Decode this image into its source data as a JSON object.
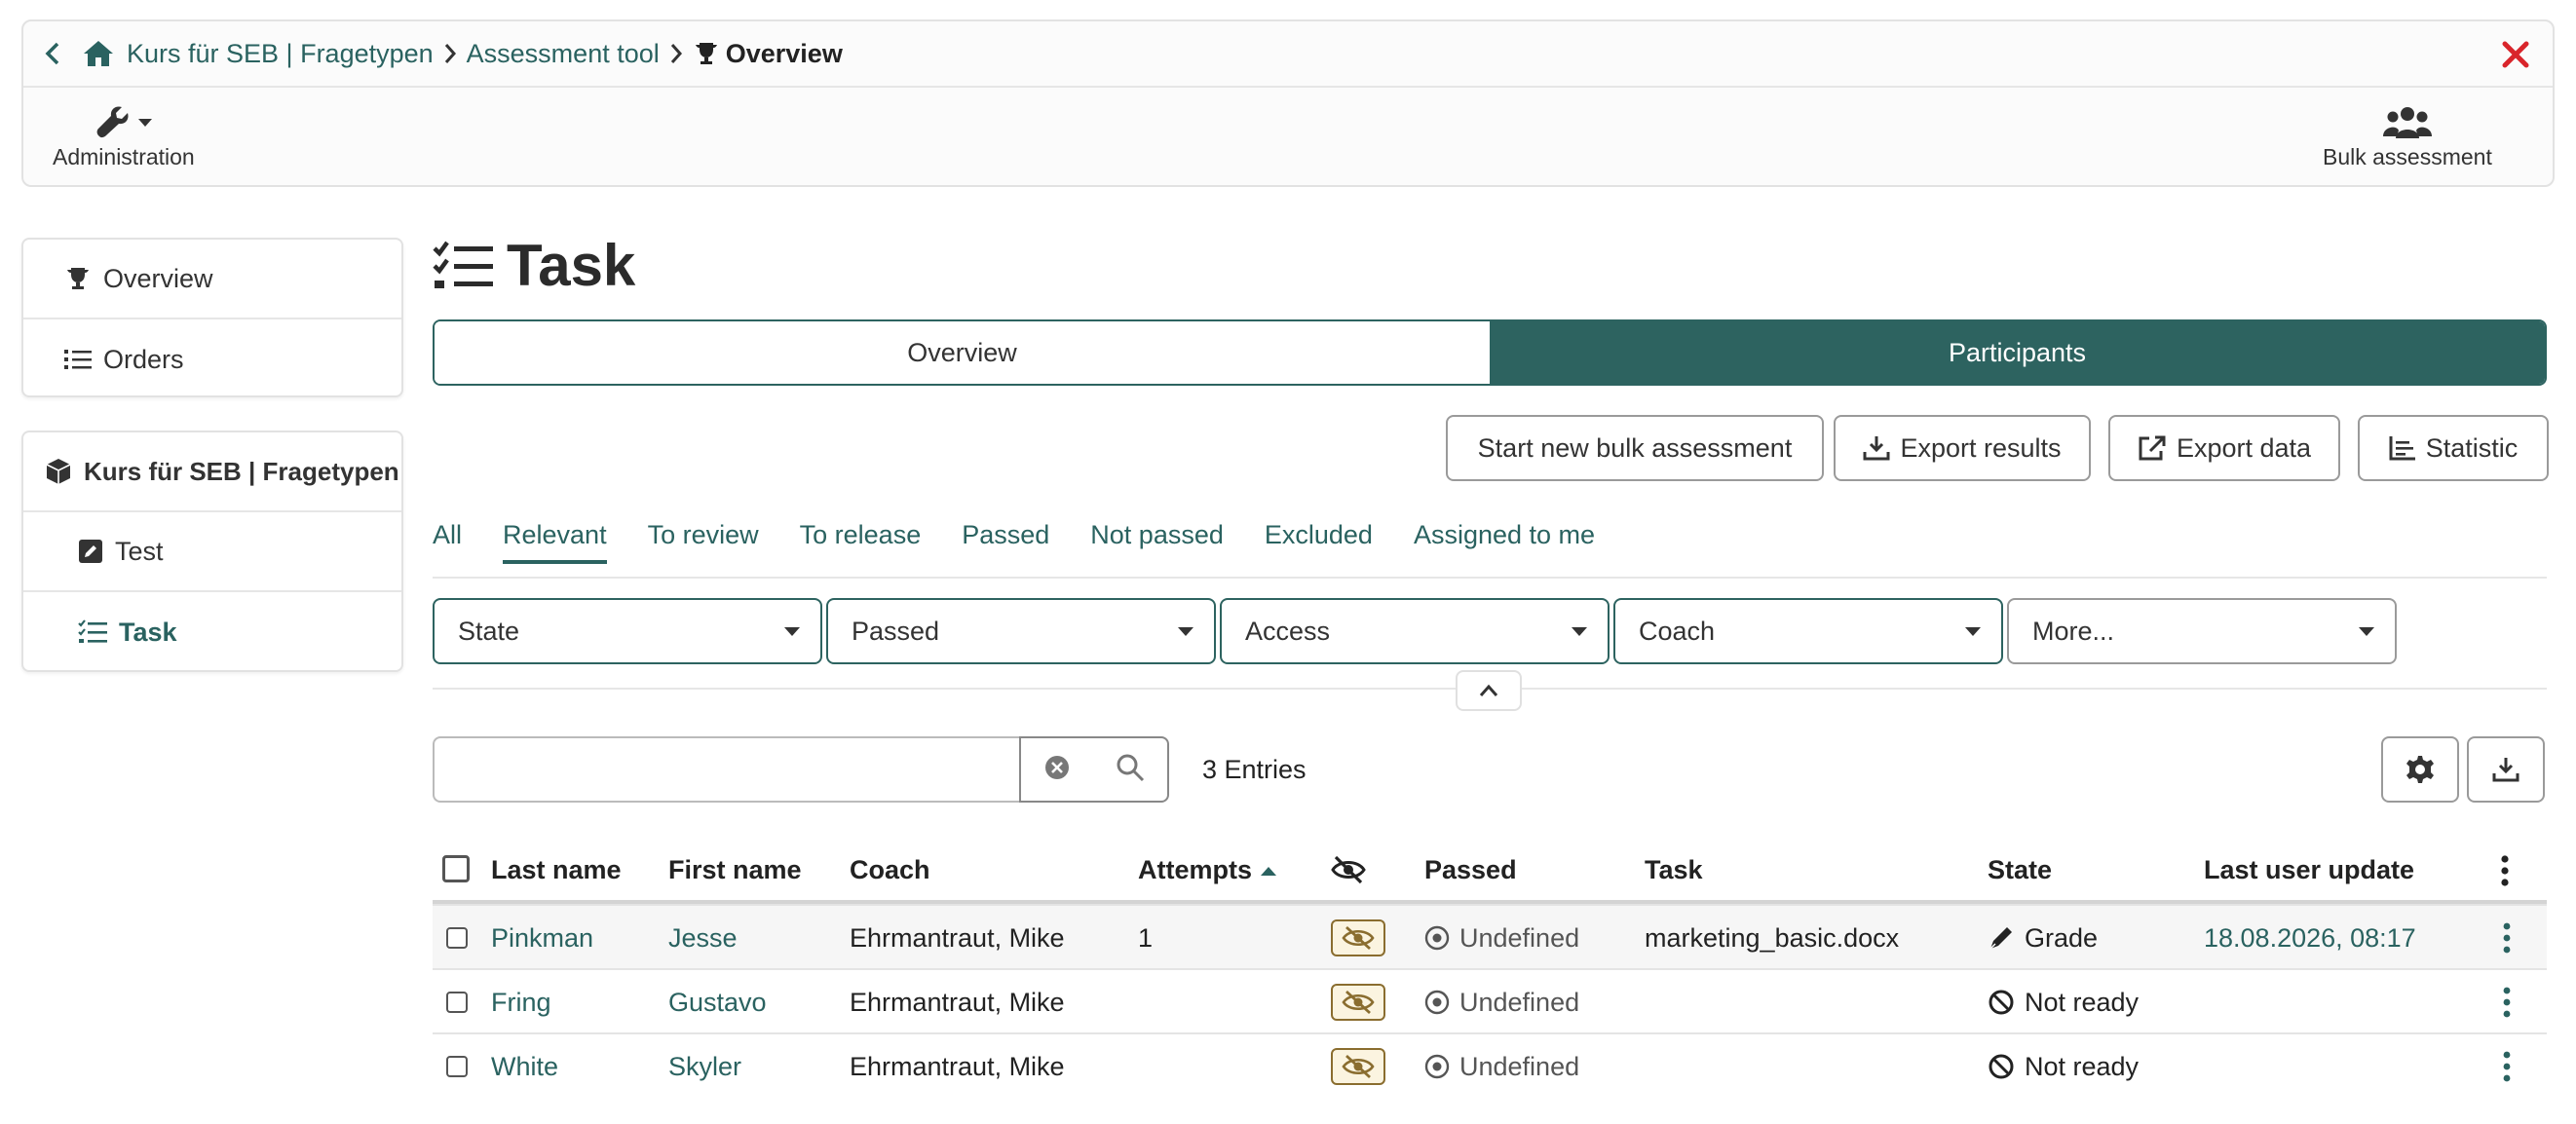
{
  "breadcrumb": {
    "items": [
      "Kurs für SEB | Fragetypen",
      "Assessment tool"
    ],
    "current": "Overview"
  },
  "toolbar": {
    "administration": "Administration",
    "bulk_assessment": "Bulk assessment"
  },
  "sidebar": {
    "group1": [
      {
        "label": "Overview",
        "icon": "trophy-icon"
      },
      {
        "label": "Orders",
        "icon": "list-icon"
      }
    ],
    "course_title": "Kurs für SEB | Fragetypen",
    "group2": [
      {
        "label": "Test",
        "icon": "edit-icon"
      },
      {
        "label": "Task",
        "icon": "tasks-icon"
      }
    ]
  },
  "page": {
    "title": "Task",
    "seg_overview": "Overview",
    "seg_participants": "Participants"
  },
  "actions": {
    "start_bulk": "Start new bulk assessment",
    "export_results": "Export results",
    "export_data": "Export data",
    "statistic": "Statistic"
  },
  "tabs": [
    "All",
    "Relevant",
    "To review",
    "To release",
    "Passed",
    "Not passed",
    "Excluded",
    "Assigned to me"
  ],
  "filters": [
    "State",
    "Passed",
    "Access",
    "Coach",
    "More..."
  ],
  "search": {
    "placeholder": "",
    "entries": "3 Entries"
  },
  "table": {
    "headers": {
      "last_name": "Last name",
      "first_name": "First name",
      "coach": "Coach",
      "attempts": "Attempts",
      "passed": "Passed",
      "task": "Task",
      "state": "State",
      "last_update": "Last user update"
    },
    "rows": [
      {
        "last": "Pinkman",
        "first": "Jesse",
        "coach": "Ehrmantraut, Mike",
        "attempts": "1",
        "passed": "Undefined",
        "task": "marketing_basic.docx",
        "state": "Grade",
        "update": "18.08.2026, 08:17"
      },
      {
        "last": "Fring",
        "first": "Gustavo",
        "coach": "Ehrmantraut, Mike",
        "attempts": "",
        "passed": "Undefined",
        "task": "",
        "state": "Not ready",
        "update": ""
      },
      {
        "last": "White",
        "first": "Skyler",
        "coach": "Ehrmantraut, Mike",
        "attempts": "",
        "passed": "Undefined",
        "task": "",
        "state": "Not ready",
        "update": ""
      }
    ]
  },
  "colors": {
    "accent": "#2d6360",
    "close": "#d9252b",
    "badge_border": "#8a6d2f"
  }
}
